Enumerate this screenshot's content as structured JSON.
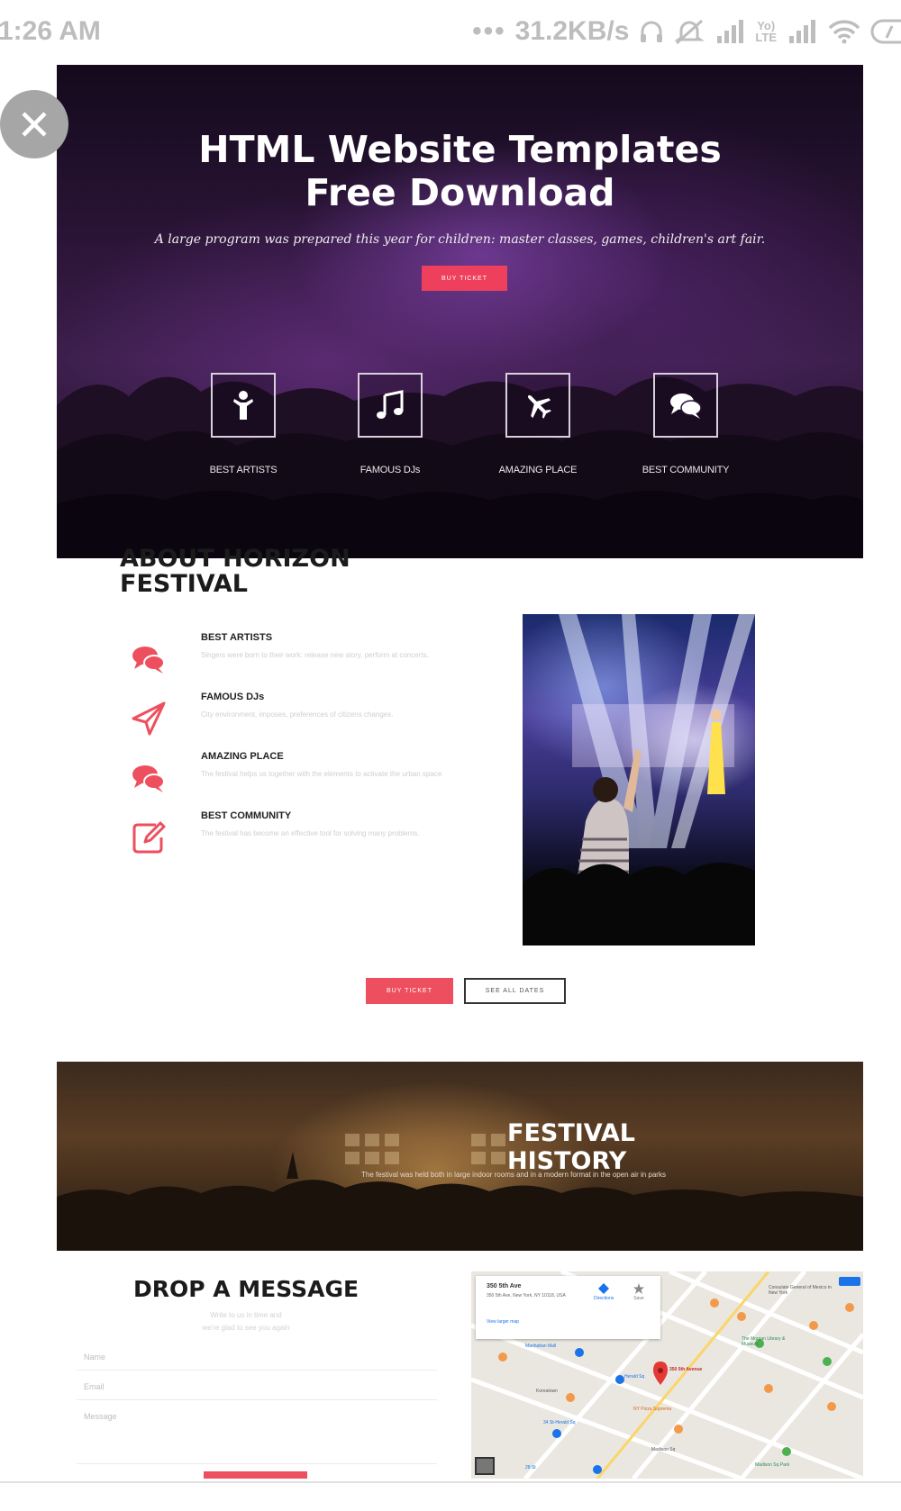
{
  "status_bar": {
    "time": "1:26 AM",
    "network_speed": "31.2KB/s",
    "icons": [
      "dots-icon",
      "headphones-icon",
      "mute-icon",
      "signal-icon",
      "volte-icon",
      "signal-icon",
      "wifi-icon",
      "battery-icon"
    ]
  },
  "hero": {
    "title_line1": "HTML Website Templates",
    "title_line2": "Free Download",
    "subtitle": "A large program was prepared this year for children: master classes, games, children's art fair.",
    "button": "BUY TICKET",
    "features": [
      {
        "label": "BEST ARTISTS",
        "icon": "person-icon"
      },
      {
        "label": "FAMOUS DJs",
        "icon": "music-note-icon"
      },
      {
        "label": "AMAZING PLACE",
        "icon": "airplane-icon"
      },
      {
        "label": "BEST COMMUNITY",
        "icon": "chat-bubbles-icon"
      }
    ]
  },
  "about": {
    "title": "ABOUT HORIZON FESTIVAL",
    "items": [
      {
        "title": "BEST ARTISTS",
        "text": "Singers were born to their work: release new story, perform at concerts.",
        "icon": "chat-bubbles-icon"
      },
      {
        "title": "FAMOUS DJs",
        "text": "City environment, imposes, preferences of citizens changes.",
        "icon": "paper-plane-icon"
      },
      {
        "title": "AMAZING PLACE",
        "text": "The festival helps us together with the elements to activate the urban space.",
        "icon": "chat-bubbles-icon"
      },
      {
        "title": "BEST COMMUNITY",
        "text": "The festival has become an effective tool for solving many problems.",
        "icon": "edit-icon"
      }
    ],
    "buy_button": "BUY TICKET",
    "dates_button": "SEE ALL DATES"
  },
  "history": {
    "title": "FESTIVAL HISTORY",
    "text": "The festival was held both in large indoor rooms and in a modern format in the open air in parks"
  },
  "contact": {
    "title": "DROP A MESSAGE",
    "subtitle_line1": "Write to us in time and",
    "subtitle_line2": "we're glad to see you again",
    "fields": {
      "name": "Name",
      "email": "Email",
      "message": "Message"
    }
  },
  "map": {
    "card_title": "350 5th Ave",
    "card_address": "350 5th Ave, New York, NY 10118, USA",
    "larger_map": "View larger map",
    "directions": "Directions",
    "save": "Save",
    "pin_label": "350 5th Avenue",
    "labels": {
      "consulate": "Consulate General of Mexico in New York",
      "morgan": "The Morgan Library & Museum",
      "manhattan_mall": "Manhattan Mall",
      "herald": "Herald Sq",
      "koreatown": "Koreatown",
      "madison": "Madison Sq",
      "ny_pizza": "NY Pizza Suprema",
      "sbs": "34 St-Herald Sq",
      "madison_park": "Madison Sq Park",
      "w28": "28 St"
    }
  }
}
